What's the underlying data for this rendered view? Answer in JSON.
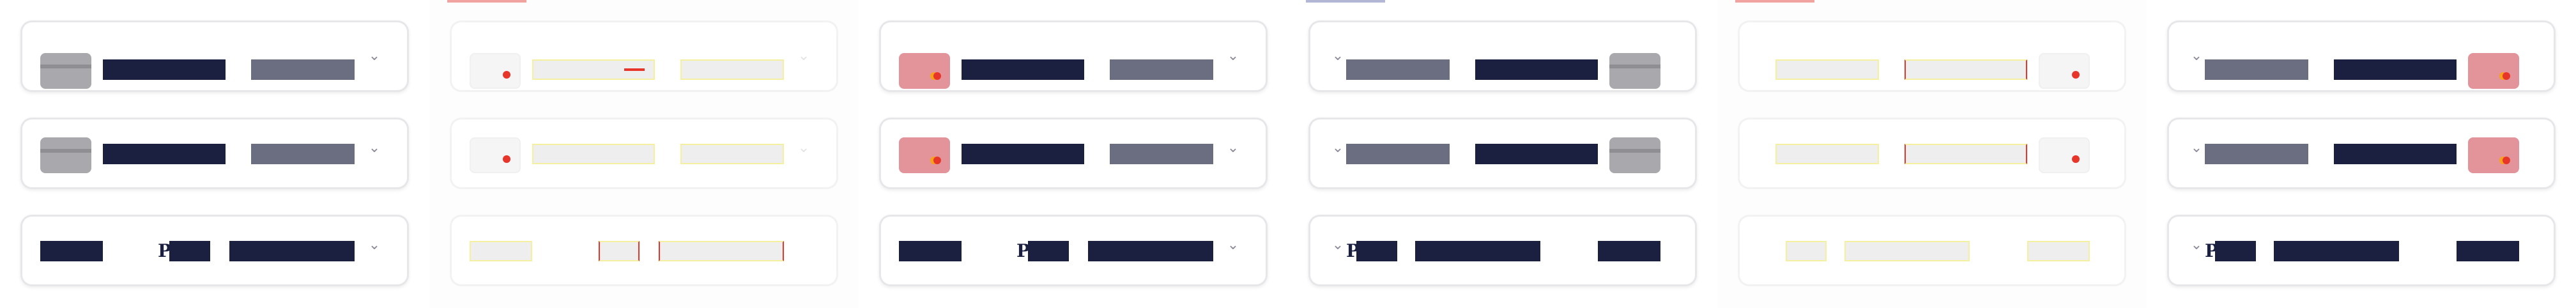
{
  "header": {
    "row_a": [
      "",
      "",
      ""
    ],
    "row_b": [
      "",
      "",
      ""
    ]
  },
  "cards": {
    "variant_1": {
      "left_label": "",
      "right_label": ""
    },
    "variant_2": {
      "left_label": "",
      "right_label": ""
    },
    "variant_3": {
      "prefix": "P",
      "right_label": ""
    }
  },
  "icons": {
    "chevron": "chevron-down-icon",
    "card_brand": "card-brand-icon"
  },
  "colors": {
    "dark": "#1c2040",
    "muted": "#6b6d80",
    "accent_red": "#e8352a",
    "accent_orange": "#f6a21a",
    "card_pink": "#e3949a",
    "thumb_gray": "#a9a9ad"
  }
}
